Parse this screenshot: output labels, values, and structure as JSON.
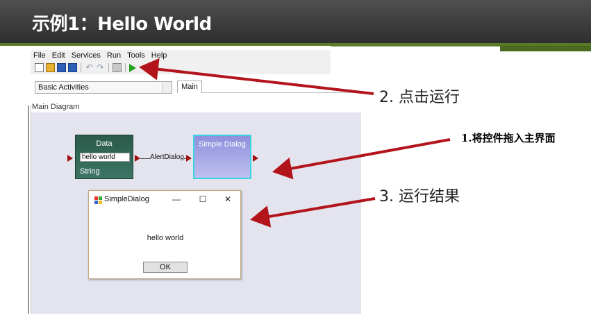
{
  "slide": {
    "title": "示例1：Hello World",
    "accent_color": "#5a7a2a",
    "annotation_color": "#b3141c"
  },
  "app": {
    "menu": [
      "File",
      "Edit",
      "Services",
      "Run",
      "Tools",
      "Help"
    ],
    "toolbar_icons": [
      "new-file-icon",
      "open-folder-icon",
      "save-icon",
      "save-all-icon",
      "undo-icon",
      "redo-icon",
      "print-icon",
      "run-icon"
    ],
    "palette": {
      "selected": "Basic Activities"
    },
    "tabs": [
      "Main"
    ],
    "diagram_label": "Main Diagram",
    "data_block": {
      "title": "Data",
      "value": "hello world",
      "type": "String"
    },
    "link_label": "AlertDialog",
    "dialog_block": {
      "title": "Simple Dialog",
      "border_color": "#39d4e0"
    },
    "popup": {
      "title": "SimpleDialog",
      "minimize": "—",
      "maximize": "☐",
      "close": "✕",
      "message": "hello world",
      "ok_label": "OK"
    }
  },
  "annotations": {
    "step1": "1.将控件拖入主界面",
    "step2": "2. 点击运行",
    "step3": "3. 运行结果"
  }
}
